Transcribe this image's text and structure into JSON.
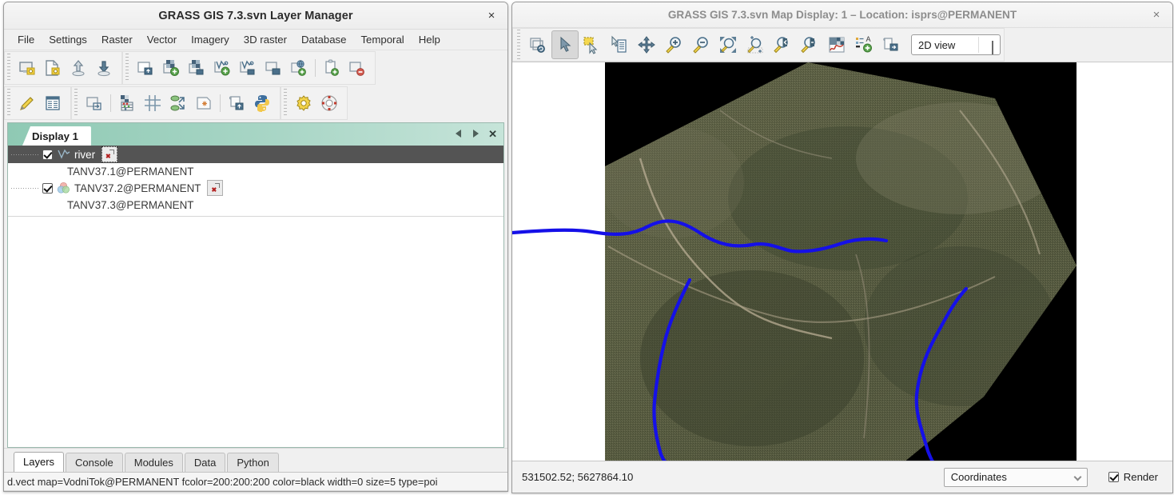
{
  "layer_manager": {
    "title": "GRASS GIS 7.3.svn Layer Manager",
    "close_label": "×",
    "menus": [
      "File",
      "Settings",
      "Raster",
      "Vector",
      "Imagery",
      "3D raster",
      "Database",
      "Temporal",
      "Help"
    ],
    "toolbar_row1": [
      {
        "name": "start-new-workspace-icon",
        "glyph": "display"
      },
      {
        "name": "load-workspace-icon",
        "glyph": "page"
      },
      {
        "name": "open-workspace-icon",
        "glyph": "arrow-up"
      },
      {
        "name": "save-workspace-icon",
        "glyph": "arrow-down"
      },
      {
        "name": "import-raster-data-icon",
        "glyph": "layer-import"
      },
      {
        "name": "add-raster-map-layer-icon",
        "glyph": "layer-add"
      },
      {
        "name": "add-various-raster-map-layers-icon",
        "glyph": "layer-raster-more"
      },
      {
        "name": "add-vector-map-layer-icon",
        "glyph": "vector-add"
      },
      {
        "name": "add-various-vector-map-layers-icon",
        "glyph": "vector-more"
      },
      {
        "name": "add-group-icon",
        "glyph": "group"
      },
      {
        "name": "add-web-service-layer-icon",
        "glyph": "web-layer"
      },
      {
        "name": "copy-map-layer-icon",
        "glyph": "copy-layer"
      },
      {
        "name": "remove-map-layer-icon",
        "glyph": "layer-remove"
      }
    ],
    "toolbar_row2": [
      {
        "name": "edit-raster-map-icon",
        "glyph": "pencil"
      },
      {
        "name": "show-attribute-table-icon",
        "glyph": "table"
      },
      {
        "name": "add-command-layer-icon",
        "glyph": "cmd-layer"
      },
      {
        "name": "raster-map-calculator-icon",
        "glyph": "calculator"
      },
      {
        "name": "georectify-icon",
        "glyph": "grid"
      },
      {
        "name": "reproject-raster-icon",
        "glyph": "reproject"
      },
      {
        "name": "map-swipe-icon",
        "glyph": "point-page"
      },
      {
        "name": "cartographic-composer-icon",
        "glyph": "composer"
      },
      {
        "name": "python-shell-icon",
        "glyph": "python"
      },
      {
        "name": "gui-settings-icon",
        "glyph": "gear"
      },
      {
        "name": "help-icon",
        "glyph": "lifering"
      }
    ],
    "display_tab": {
      "label": "Display 1",
      "prev_icon": "previous-page-icon",
      "next_icon": "next-page-icon",
      "close_icon": "close-display-icon"
    },
    "layer_tree": {
      "rows": [
        {
          "label": "river",
          "type": "vector",
          "checked": true,
          "selected": true,
          "has_opacity_button": true,
          "opacity_focused": true
        },
        {
          "label": "TANV37.1@PERMANENT",
          "type": "group-child",
          "checked": false,
          "selected": false,
          "has_opacity_button": false
        },
        {
          "label": "TANV37.2@PERMANENT",
          "type": "rgb",
          "checked": true,
          "selected": false,
          "has_opacity_button": true,
          "opacity_focused": false
        },
        {
          "label": "TANV37.3@PERMANENT",
          "type": "group-child",
          "checked": false,
          "selected": false,
          "has_opacity_button": false
        }
      ]
    },
    "bottom_tabs": [
      {
        "label": "Layers",
        "active": true
      },
      {
        "label": "Console",
        "active": false
      },
      {
        "label": "Modules",
        "active": false
      },
      {
        "label": "Data",
        "active": false
      },
      {
        "label": "Python",
        "active": false
      }
    ],
    "status_text": "d.vect map=VodniTok@PERMANENT fcolor=200:200:200 color=black width=0 size=5 type=poi"
  },
  "map_display": {
    "title": "GRASS GIS 7.3.svn Map Display: 1 – Location: isprs@PERMANENT",
    "close_label": "×",
    "toolbar": [
      {
        "name": "render-map-icon",
        "glyph": "render",
        "active": false
      },
      {
        "name": "pointer-tool-icon",
        "glyph": "pointer",
        "active": true
      },
      {
        "name": "select-features-icon",
        "glyph": "select-box",
        "active": false
      },
      {
        "name": "query-raster-vector-icon",
        "glyph": "query",
        "active": false
      },
      {
        "name": "pan-tool-icon",
        "glyph": "pan",
        "active": false
      },
      {
        "name": "zoom-in-icon",
        "glyph": "zoom-in",
        "active": false
      },
      {
        "name": "zoom-out-icon",
        "glyph": "zoom-out",
        "active": false
      },
      {
        "name": "zoom-to-selected-icon",
        "glyph": "zoom-extent",
        "active": false
      },
      {
        "name": "zoom-to-region-icon",
        "glyph": "zoom-region",
        "active": false
      },
      {
        "name": "zoom-back-icon",
        "glyph": "zoom-back",
        "active": false
      },
      {
        "name": "zoom-menu-icon",
        "glyph": "zoom-more",
        "active": false
      },
      {
        "name": "analyze-map-icon",
        "glyph": "histogram",
        "active": false
      },
      {
        "name": "add-map-elements-icon",
        "glyph": "legend-add",
        "active": false
      },
      {
        "name": "save-display-to-file-icon",
        "glyph": "save-file",
        "active": false
      }
    ],
    "view_mode": {
      "value": "2D view",
      "chevron_icon": "chevron-down-icon"
    },
    "coordinates": "531502.52; 5627864.10",
    "status_selector": {
      "value": "Coordinates",
      "chevron_icon": "chevron-down-icon"
    },
    "render": {
      "label": "Render",
      "checked": true
    }
  },
  "colors": {
    "tab_teal": "#8fc9b4",
    "selection_gray": "#545454",
    "river_blue": "#1510e8",
    "raster_black": "#000000",
    "canvas_white": "#ffffff"
  }
}
